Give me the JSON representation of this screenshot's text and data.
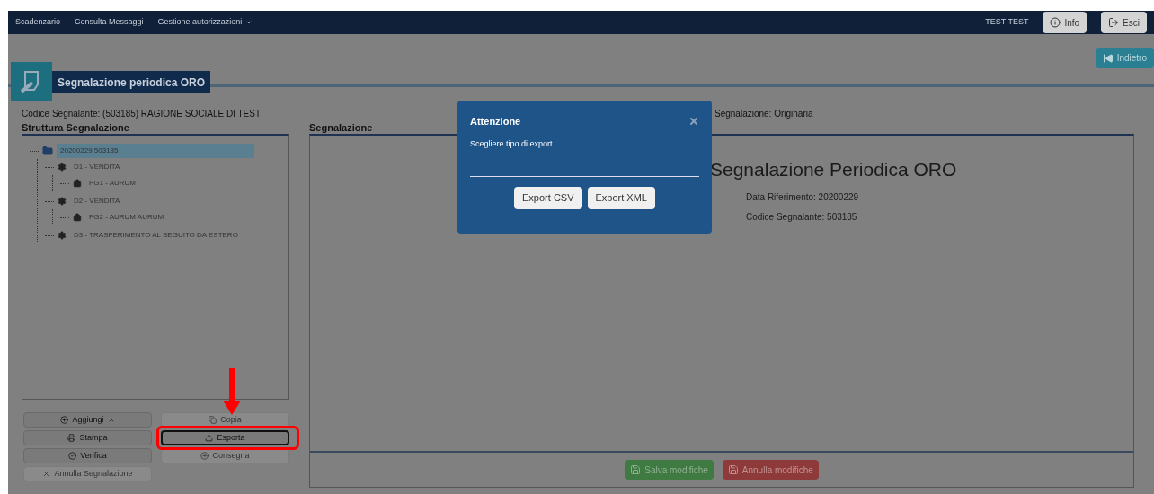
{
  "navbar": {
    "links": [
      {
        "label": "Scadenzario",
        "dropdown": false
      },
      {
        "label": "Consulta Messaggi",
        "dropdown": false
      },
      {
        "label": "Gestione autorizzazioni",
        "dropdown": true
      }
    ],
    "user": "TEST TEST",
    "buttons": [
      {
        "label": "Info",
        "kind": "info"
      },
      {
        "label": "Esci",
        "kind": "logout"
      }
    ]
  },
  "back_button": "Indietro",
  "page_title": "Segnalazione periodica ORO",
  "codice_segnalante": "Codice Segnalante: (503185) RAGIONE SOCIALE DI TEST",
  "tipo_segnalazione": "Segnalazione: Originaria",
  "tree": {
    "title": "Struttura Segnalazione",
    "nodes": [
      {
        "label": "20200229 503185",
        "kind": "root",
        "selected": true,
        "children": [
          {
            "label": "D1 - VENDITA",
            "kind": "group",
            "selected": false,
            "children": [
              {
                "label": "PG1 - AURUM",
                "kind": "item",
                "selected": false
              }
            ]
          },
          {
            "label": "D2 - VENDITA",
            "kind": "group",
            "selected": false,
            "children": [
              {
                "label": "PG2 - AURUM AURUM",
                "kind": "item",
                "selected": false
              }
            ]
          },
          {
            "label": "D3 - TRASFERIMENTO AL SEGUITO DA ESTERO",
            "kind": "group",
            "selected": false
          }
        ]
      }
    ]
  },
  "actions": [
    {
      "label": "Aggiungi",
      "disabled": false,
      "dropdown": true,
      "focused": false
    },
    {
      "label": "Copia",
      "disabled": true,
      "dropdown": false,
      "focused": false
    },
    {
      "label": "Stampa",
      "disabled": false,
      "dropdown": false,
      "focused": false
    },
    {
      "label": "Esporta",
      "disabled": false,
      "dropdown": false,
      "focused": true
    },
    {
      "label": "Verifica",
      "disabled": false,
      "dropdown": false,
      "focused": false
    },
    {
      "label": "Consegna",
      "disabled": true,
      "dropdown": false,
      "focused": false
    },
    {
      "label": "Annulla Segnalazione",
      "disabled": true,
      "dropdown": false,
      "focused": false
    }
  ],
  "report": {
    "title": "Segnalazione",
    "heading": "Segnalazione Periodica ORO",
    "lines": [
      "Data Riferimento: 20200229",
      "Codice Segnalante: 503185"
    ]
  },
  "footer_buttons": [
    {
      "label": "Salva modifiche",
      "kind": "save"
    },
    {
      "label": "Annulla modifiche",
      "kind": "cancel"
    }
  ],
  "modal": {
    "title": "Attenzione",
    "message": "Scegliere tipo di export",
    "buttons": [
      "Export CSV",
      "Export XML"
    ]
  }
}
